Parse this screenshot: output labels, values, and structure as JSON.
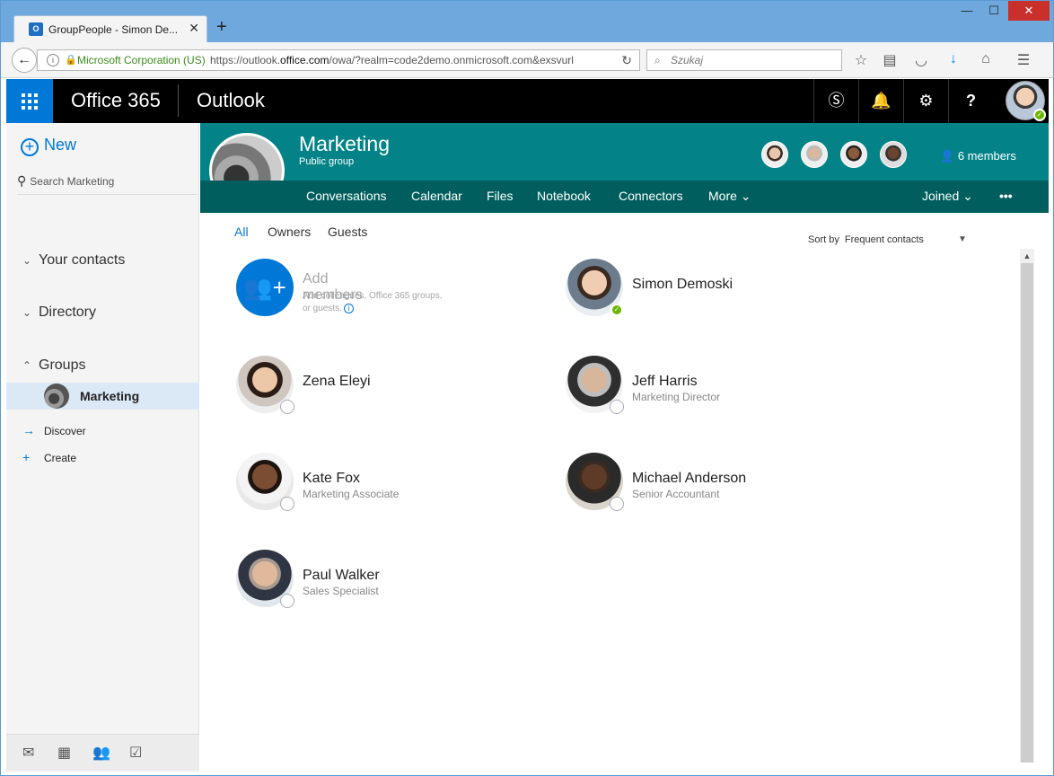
{
  "browser": {
    "tab_title": "GroupPeople - Simon De...",
    "tab_close": "✕",
    "new_tab": "+",
    "win_minimize": "—",
    "win_maximize": "☐",
    "win_close": "✕",
    "site_identity": "Microsoft Corporation (US)",
    "url_prefix": "https://outlook.",
    "url_domain": "office.com",
    "url_suffix": "/owa/?realm=code2demo.onmicrosoft.com&exsvurl",
    "search_placeholder": "Szukaj",
    "icons": [
      "back-icon",
      "info-icon",
      "lock-icon",
      "reload-icon",
      "search-icon",
      "star-icon",
      "reading-list-icon",
      "pocket-icon",
      "download-icon",
      "home-icon",
      "menu-icon"
    ]
  },
  "suite": {
    "app_name": "Office 365",
    "product": "Outlook",
    "header_icons": [
      "waffle-icon",
      "skype-icon",
      "bell-icon",
      "gear-icon",
      "help-icon",
      "profile-avatar"
    ]
  },
  "left_nav": {
    "new_label": "New",
    "search_label": "Search Marketing",
    "your_contacts": "Your contacts",
    "directory": "Directory",
    "groups": "Groups",
    "selected_group": "Marketing",
    "discover": "Discover",
    "create": "Create",
    "bottom_icons": [
      "mail-icon",
      "calendar-icon",
      "people-icon",
      "tasks-icon"
    ]
  },
  "group": {
    "name": "Marketing",
    "type": "Public group",
    "members_count": "6 members",
    "nav": [
      "Conversations",
      "Calendar",
      "Files",
      "Notebook",
      "Connectors",
      "More"
    ],
    "joined": "Joined",
    "more_dots": "•••"
  },
  "filters": [
    "All",
    "Owners",
    "Guests"
  ],
  "sort": {
    "label": "Sort by",
    "value": "Frequent contacts"
  },
  "add_members": {
    "title": "Add members",
    "line1": "Add colleagues, Office 365 groups,",
    "line2": "or guests."
  },
  "members": [
    {
      "name": "Simon Demoski",
      "title": "",
      "status": "available"
    },
    {
      "name": "Zena Eleyi",
      "title": "",
      "status": "offline"
    },
    {
      "name": "Jeff Harris",
      "title": "Marketing Director",
      "status": "offline"
    },
    {
      "name": "Kate Fox",
      "title": "Marketing Associate",
      "status": "offline"
    },
    {
      "name": "Michael Anderson",
      "title": "Senior Accountant",
      "status": "offline"
    },
    {
      "name": "Paul Walker",
      "title": "Sales Specialist",
      "status": "offline"
    }
  ],
  "colors": {
    "accent": "#0078d7",
    "group_header": "#038387",
    "group_nav": "#005e5e",
    "presence_available": "#6bb700"
  }
}
